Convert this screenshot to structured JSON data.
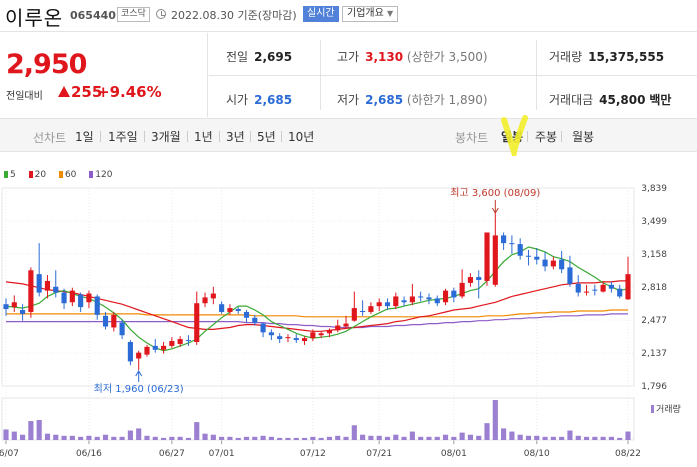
{
  "header": {
    "name": "이루온",
    "code": "065440",
    "market": "코스닥",
    "date": "2022.08.30",
    "date_suffix": "기준(장마감)",
    "realtime_label": "실시간",
    "company_info_label": "기업개요"
  },
  "summary": {
    "price": "2,950",
    "change_label": "전일대비",
    "change": "255",
    "change_rate": "+9.46%"
  },
  "stats": {
    "prev_close": {
      "label": "전일",
      "value": "2,695"
    },
    "high": {
      "label": "고가",
      "value": "3,130",
      "note": "(상한가 3,500)"
    },
    "volume": {
      "label": "거래량",
      "value": "15,375,555"
    },
    "open": {
      "label": "시가",
      "value": "2,685"
    },
    "low": {
      "label": "저가",
      "value": "2,685",
      "note": "(하한가 1,890)"
    },
    "amount": {
      "label": "거래대금",
      "value": "45,800",
      "unit": "백만"
    }
  },
  "period_tabs": {
    "line_label": "선차트",
    "line_items": [
      "1일",
      "1주일",
      "3개월",
      "1년",
      "3년",
      "5년",
      "10년"
    ],
    "candle_label": "봉차트",
    "candle_items": [
      "일봉",
      "주봉",
      "월봉"
    ],
    "active": "일봉"
  },
  "chart_data": {
    "type": "candlestick",
    "legend": [
      {
        "name": "5",
        "color": "#3aaa35"
      },
      {
        "name": "20",
        "color": "#e0161d"
      },
      {
        "name": "60",
        "color": "#f08a00"
      },
      {
        "name": "120",
        "color": "#8e5cc9"
      }
    ],
    "y_ticks": [
      "3,839",
      "3,499",
      "3,158",
      "2,818",
      "2,477",
      "2,137",
      "1,796"
    ],
    "ylim": [
      1796,
      3839
    ],
    "x_ticks": [
      "06/07",
      "06/16",
      "06/27",
      "07/01",
      "07/12",
      "07/21",
      "08/01",
      "08/10",
      "08/22"
    ],
    "annotation_high": "최고 3,600 (08/09)",
    "annotation_low": "최저 1,960 (06/23)",
    "volume_label": "거래량",
    "up_color": "#e0161d",
    "down_color": "#2a6bd6",
    "volume_color": "#9b7fd0",
    "candles": [
      [
        2640,
        2590,
        2700,
        2520
      ],
      [
        2610,
        2660,
        2730,
        2560
      ],
      [
        2580,
        2540,
        2640,
        2470
      ],
      [
        2560,
        2990,
        3020,
        2500
      ],
      [
        2950,
        2760,
        3270,
        2720
      ],
      [
        2780,
        2880,
        2940,
        2700
      ],
      [
        2820,
        2760,
        2990,
        2710
      ],
      [
        2760,
        2650,
        2800,
        2590
      ],
      [
        2660,
        2780,
        2810,
        2620
      ],
      [
        2740,
        2610,
        2760,
        2560
      ],
      [
        2660,
        2750,
        2780,
        2600
      ],
      [
        2720,
        2530,
        2740,
        2480
      ],
      [
        2520,
        2410,
        2560,
        2380
      ],
      [
        2400,
        2530,
        2560,
        2360
      ],
      [
        2450,
        2320,
        2480,
        2280
      ],
      [
        2250,
        2050,
        2270,
        2010
      ],
      [
        2080,
        2140,
        2160,
        1960
      ],
      [
        2120,
        2200,
        2220,
        2100
      ],
      [
        2210,
        2170,
        2280,
        2140
      ],
      [
        2170,
        2210,
        2250,
        2130
      ],
      [
        2210,
        2260,
        2300,
        2190
      ],
      [
        2230,
        2280,
        2310,
        2200
      ],
      [
        2270,
        2260,
        2320,
        2210
      ],
      [
        2250,
        2650,
        2770,
        2220
      ],
      [
        2650,
        2710,
        2760,
        2610
      ],
      [
        2700,
        2750,
        2820,
        2640
      ],
      [
        2640,
        2560,
        2670,
        2540
      ],
      [
        2560,
        2600,
        2640,
        2530
      ],
      [
        2590,
        2570,
        2610,
        2540
      ],
      [
        2560,
        2500,
        2580,
        2450
      ],
      [
        2500,
        2450,
        2530,
        2420
      ],
      [
        2440,
        2350,
        2450,
        2300
      ],
      [
        2350,
        2320,
        2380,
        2270
      ],
      [
        2310,
        2280,
        2340,
        2240
      ],
      [
        2290,
        2300,
        2330,
        2250
      ],
      [
        2290,
        2270,
        2330,
        2240
      ],
      [
        2260,
        2290,
        2310,
        2220
      ],
      [
        2290,
        2350,
        2380,
        2260
      ],
      [
        2320,
        2340,
        2360,
        2290
      ],
      [
        2340,
        2370,
        2390,
        2300
      ],
      [
        2370,
        2420,
        2480,
        2350
      ],
      [
        2410,
        2440,
        2520,
        2390
      ],
      [
        2470,
        2600,
        2770,
        2460
      ],
      [
        2570,
        2560,
        2680,
        2520
      ],
      [
        2560,
        2620,
        2660,
        2540
      ],
      [
        2620,
        2660,
        2700,
        2570
      ],
      [
        2660,
        2620,
        2700,
        2580
      ],
      [
        2620,
        2720,
        2760,
        2590
      ],
      [
        2680,
        2660,
        2720,
        2620
      ],
      [
        2660,
        2720,
        2850,
        2630
      ],
      [
        2720,
        2710,
        2770,
        2670
      ],
      [
        2710,
        2690,
        2750,
        2640
      ],
      [
        2700,
        2650,
        2730,
        2620
      ],
      [
        2660,
        2780,
        2800,
        2630
      ],
      [
        2780,
        2710,
        2810,
        2660
      ],
      [
        2720,
        2860,
        3000,
        2700
      ],
      [
        2860,
        2920,
        2960,
        2820
      ],
      [
        2920,
        2890,
        2990,
        2700
      ],
      [
        2880,
        3380,
        3380,
        2830
      ],
      [
        2840,
        3350,
        3600,
        2820
      ],
      [
        3350,
        3270,
        3380,
        3200
      ],
      [
        3270,
        3260,
        3350,
        3160
      ],
      [
        3260,
        3140,
        3320,
        3100
      ],
      [
        3140,
        3130,
        3200,
        3040
      ],
      [
        3130,
        3100,
        3220,
        3050
      ],
      [
        3100,
        3030,
        3180,
        2980
      ],
      [
        3030,
        3090,
        3130,
        3000
      ],
      [
        3100,
        3000,
        3190,
        2960
      ],
      [
        3020,
        2850,
        3140,
        2820
      ],
      [
        2850,
        2760,
        2940,
        2720
      ],
      [
        2760,
        2770,
        2840,
        2730
      ],
      [
        2790,
        2780,
        2840,
        2730
      ],
      [
        2770,
        2840,
        2880,
        2760
      ],
      [
        2840,
        2800,
        2870,
        2760
      ],
      [
        2800,
        2720,
        2840,
        2700
      ],
      [
        2690,
        2950,
        3130,
        2685
      ]
    ],
    "ma5": [
      2620,
      2610,
      2600,
      2620,
      2650,
      2720,
      2760,
      2780,
      2750,
      2720,
      2700,
      2660,
      2610,
      2550,
      2480,
      2380,
      2300,
      2240,
      2190,
      2160,
      2180,
      2210,
      2240,
      2280,
      2360,
      2430,
      2500,
      2560,
      2620,
      2620,
      2580,
      2530,
      2460,
      2420,
      2380,
      2340,
      2310,
      2290,
      2300,
      2310,
      2330,
      2360,
      2410,
      2460,
      2510,
      2550,
      2590,
      2600,
      2620,
      2640,
      2660,
      2680,
      2690,
      2700,
      2720,
      2750,
      2780,
      2800,
      2880,
      2980,
      3080,
      3150,
      3180,
      3230,
      3210,
      3180,
      3130,
      3110,
      3080,
      3020,
      2970,
      2920,
      2860,
      2820,
      2780,
      2800
    ],
    "ma20": [
      2870,
      2860,
      2850,
      2830,
      2810,
      2790,
      2780,
      2770,
      2760,
      2740,
      2720,
      2700,
      2680,
      2660,
      2640,
      2610,
      2580,
      2550,
      2520,
      2490,
      2460,
      2430,
      2400,
      2390,
      2380,
      2380,
      2390,
      2400,
      2420,
      2430,
      2430,
      2420,
      2410,
      2400,
      2390,
      2380,
      2370,
      2360,
      2360,
      2370,
      2380,
      2390,
      2400,
      2410,
      2420,
      2430,
      2440,
      2460,
      2470,
      2490,
      2510,
      2520,
      2540,
      2560,
      2580,
      2590,
      2600,
      2620,
      2640,
      2660,
      2690,
      2720,
      2740,
      2760,
      2780,
      2800,
      2820,
      2840,
      2850,
      2860,
      2860,
      2860,
      2870,
      2870,
      2880,
      2880
    ],
    "ma60": [
      2540,
      2540,
      2540,
      2540,
      2540,
      2540,
      2540,
      2540,
      2540,
      2540,
      2540,
      2540,
      2540,
      2540,
      2540,
      2540,
      2540,
      2530,
      2530,
      2530,
      2530,
      2530,
      2530,
      2530,
      2530,
      2530,
      2530,
      2530,
      2530,
      2530,
      2520,
      2520,
      2520,
      2520,
      2520,
      2520,
      2510,
      2510,
      2510,
      2510,
      2510,
      2510,
      2510,
      2510,
      2510,
      2510,
      2510,
      2510,
      2510,
      2510,
      2510,
      2510,
      2510,
      2510,
      2510,
      2510,
      2510,
      2510,
      2520,
      2520,
      2520,
      2530,
      2540,
      2540,
      2550,
      2550,
      2560,
      2560,
      2560,
      2570,
      2570,
      2570,
      2570,
      2580,
      2580,
      2580
    ],
    "ma120": [
      2460,
      2460,
      2460,
      2460,
      2460,
      2460,
      2460,
      2460,
      2460,
      2460,
      2460,
      2460,
      2460,
      2460,
      2460,
      2460,
      2460,
      2460,
      2460,
      2460,
      2460,
      2460,
      2460,
      2460,
      2460,
      2460,
      2460,
      2460,
      2460,
      2450,
      2450,
      2450,
      2440,
      2440,
      2430,
      2430,
      2420,
      2420,
      2410,
      2410,
      2400,
      2400,
      2400,
      2400,
      2410,
      2410,
      2410,
      2420,
      2420,
      2430,
      2430,
      2440,
      2440,
      2450,
      2450,
      2460,
      2460,
      2470,
      2470,
      2480,
      2480,
      2490,
      2490,
      2500,
      2500,
      2510,
      2510,
      2520,
      2520,
      2520,
      2530,
      2530,
      2530,
      2540,
      2540,
      2540
    ],
    "volume": [
      1.0,
      0.8,
      0.5,
      1.8,
      1.9,
      0.6,
      0.5,
      0.4,
      0.4,
      0.3,
      0.4,
      0.3,
      0.5,
      0.3,
      0.3,
      0.9,
      1.1,
      0.4,
      0.3,
      0.2,
      0.3,
      0.3,
      0.2,
      1.7,
      0.6,
      0.5,
      0.3,
      0.3,
      0.2,
      0.3,
      0.3,
      0.4,
      0.3,
      0.2,
      0.2,
      0.2,
      0.2,
      0.3,
      0.2,
      0.3,
      0.4,
      0.3,
      1.4,
      0.5,
      0.4,
      0.4,
      0.3,
      0.5,
      0.3,
      0.8,
      0.3,
      0.3,
      0.3,
      0.5,
      0.3,
      0.7,
      0.5,
      0.4,
      1.6,
      3.8,
      1.1,
      0.8,
      0.5,
      0.4,
      0.4,
      0.3,
      0.3,
      0.3,
      0.9,
      0.4,
      0.3,
      0.3,
      0.3,
      0.3,
      0.2,
      0.8
    ]
  }
}
